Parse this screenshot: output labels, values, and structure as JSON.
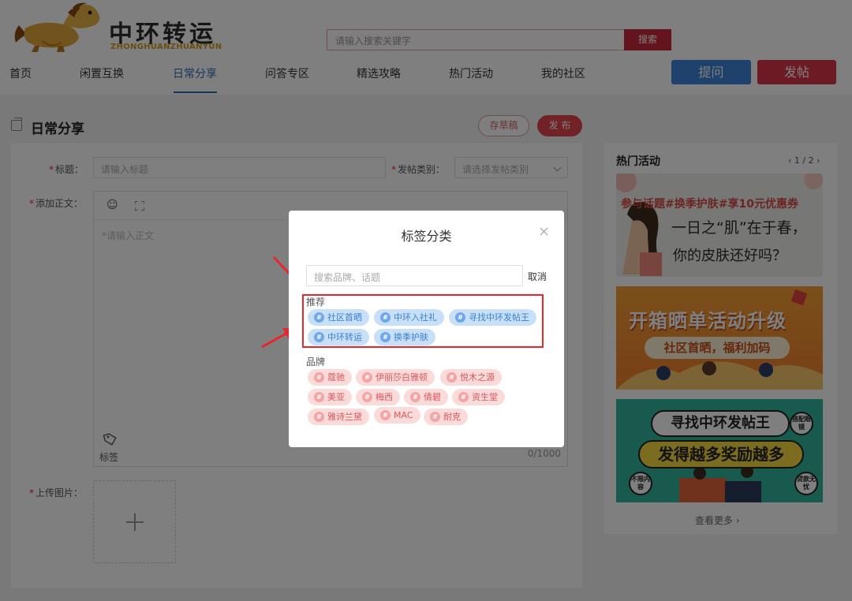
{
  "header": {
    "logo_title": "中环转运",
    "logo_subtitle": "ZHONGHUANZHUANYUN",
    "search_placeholder": "请输入搜索关键字",
    "search_button": "搜索",
    "nav": [
      "首页",
      "闲置互换",
      "日常分享",
      "问答专区",
      "精选攻略",
      "热门活动",
      "我的社区"
    ],
    "active_nav": "日常分享",
    "ask_button": "提问",
    "post_button": "发帖"
  },
  "page": {
    "title": "日常分享",
    "draft_button": "存草稿",
    "publish_button": "发 布"
  },
  "form": {
    "title_label": "标题：",
    "title_placeholder": "请输入标题",
    "category_label": "发帖类别：",
    "category_placeholder": "请选择发帖类别",
    "body_label": "添加正文：",
    "body_placeholder": "*请输入正文",
    "counter": "0/1000",
    "tag_label": "标签",
    "upload_label": "上传图片："
  },
  "sidebar": {
    "title": "热门活动",
    "pager": "‹ 1 / 2 ›",
    "banners": [
      {
        "tag": "参与话题#换季护肤#享10元优惠券",
        "line1": "一日之“肌”在于春，",
        "line2": "你的皮肤还好吗？"
      },
      {
        "title": "开箱晒单活动升级",
        "pill": "社区首晒，福利加码"
      },
      {
        "line1": "寻找中环发帖王",
        "line2": "发得越多奖励越多",
        "badge_left": "不限内容",
        "badge_right_top": "搭配眼镜",
        "badge_right": "贷款无忧"
      }
    ],
    "see_more": "查看更多 ›"
  },
  "modal": {
    "title": "标签分类",
    "search_placeholder": "搜索品牌、话题",
    "cancel": "取消",
    "recommend_label": "推荐",
    "recommend_tags": [
      "社区首晒",
      "中环入社礼",
      "寻找中环发帖王",
      "中环转运",
      "换季护肤"
    ],
    "brand_label": "品牌",
    "brand_tags": [
      "蔻驰",
      "伊丽莎白雅顿",
      "悦木之源",
      "美亚",
      "梅西",
      "倩碧",
      "资生堂",
      "雅诗兰黛",
      "MAC",
      "耐克"
    ],
    "hash_symbol": "#"
  },
  "colors": {
    "accent_blue": "#2b6cb5",
    "brand_red": "#c9283a",
    "tag_blue_bg": "#c7e0f8",
    "tag_pink_bg": "#fbdada",
    "annotation_red": "#e6262a"
  }
}
